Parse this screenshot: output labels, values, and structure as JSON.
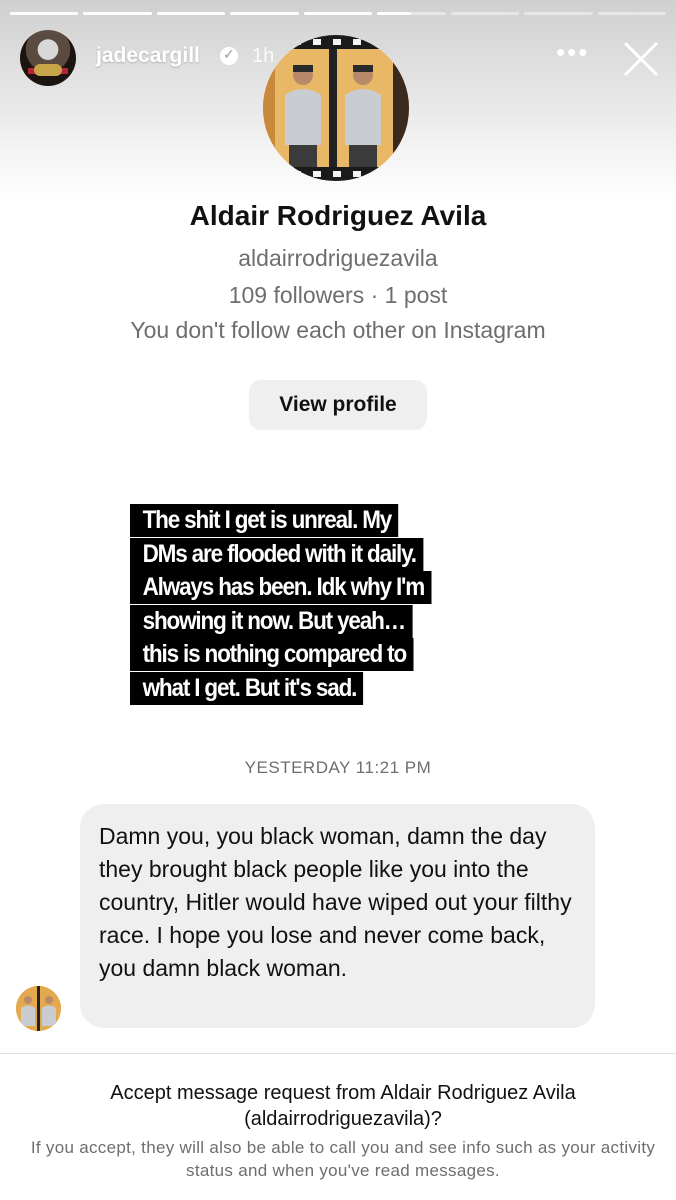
{
  "story": {
    "progress": [
      1,
      1,
      1,
      1,
      1,
      0.5,
      0,
      0,
      0
    ],
    "username": "jadecargill",
    "time_ago": "1h",
    "verified_icon": "verified-badge-icon",
    "more_icon": "more-horizontal-icon",
    "close_icon": "close-icon"
  },
  "profile": {
    "name": "Aldair Rodriguez Avila",
    "handle": "aldairrodriguezavila",
    "stats": "109 followers · 1 post",
    "relationship": "You don't follow each other on Instagram",
    "view_profile_label": "View profile"
  },
  "caption": {
    "text": "The shit I get is unreal. My DMs are flooded with it daily. Always has been. Idk why I'm showing it now. But yeah…this is nothing compared to what I get. But it's sad."
  },
  "conversation": {
    "timestamp": "YESTERDAY 11:21 PM",
    "message": "Damn you, you black woman, damn the day they brought black people like you into the country, Hitler would have wiped out your filthy race. I hope you lose and never come back, you damn black woman."
  },
  "request": {
    "title": "Accept message request from Aldair Rodriguez Avila (aldairrodriguezavila)?",
    "note": "If you accept, they will also be able to call you and see info such as your activity status and when you've read messages."
  },
  "colors": {
    "secondary_text": "#6e6e6e",
    "bubble": "#efefef",
    "caption_bg": "#000000"
  }
}
